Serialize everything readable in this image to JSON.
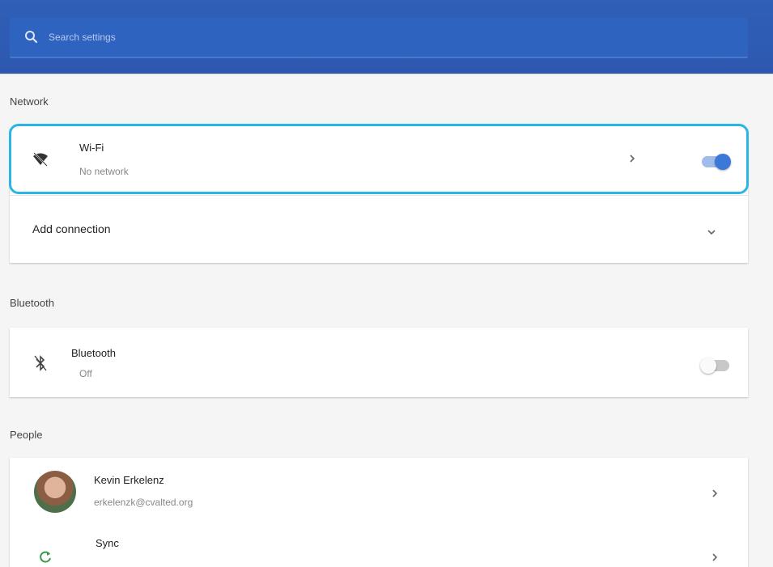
{
  "search": {
    "placeholder": "Search settings"
  },
  "sections": {
    "network": {
      "title": "Network",
      "wifi": {
        "label": "Wi-Fi",
        "status": "No network",
        "enabled": true
      },
      "add_connection": {
        "label": "Add connection"
      }
    },
    "bluetooth": {
      "title": "Bluetooth",
      "item": {
        "label": "Bluetooth",
        "status": "Off",
        "enabled": false
      }
    },
    "people": {
      "title": "People",
      "account": {
        "name": "Kevin Erkelenz",
        "email": "erkelenzk@cvalted.org"
      },
      "sync": {
        "label": "Sync"
      }
    }
  },
  "colors": {
    "header": "#2f5fb8",
    "accent": "#3b78d8",
    "focus": "#2bb4e6"
  },
  "icons": [
    "search-icon",
    "wifi-off-icon",
    "chevron-down-icon",
    "bluetooth-disabled-icon",
    "sync-icon",
    "arrow-right-icon"
  ]
}
